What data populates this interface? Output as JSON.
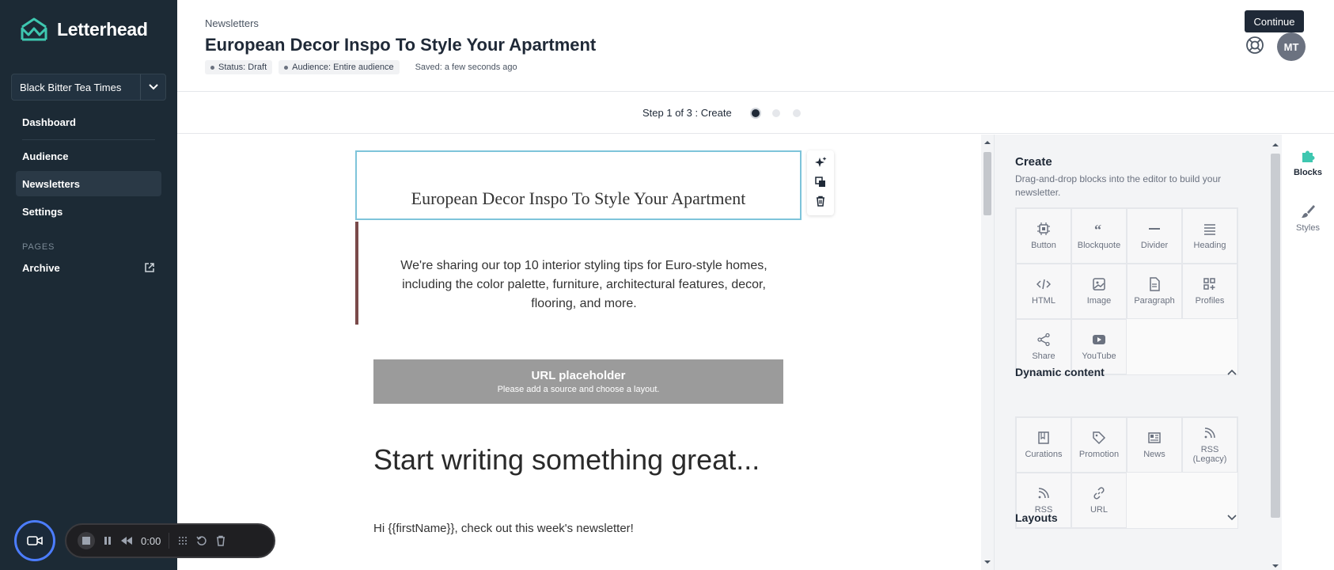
{
  "sidebar": {
    "logo_text": "Letterhead",
    "publication": "Black Bitter Tea Times",
    "nav": [
      {
        "label": "Dashboard"
      },
      {
        "label": "Audience"
      },
      {
        "label": "Newsletters"
      },
      {
        "label": "Settings"
      }
    ],
    "pages_section": "PAGES",
    "archive_label": "Archive"
  },
  "header": {
    "breadcrumb": "Newsletters",
    "title": "European Decor Inspo To Style Your Apartment",
    "status": "Status: Draft",
    "audience": "Audience: Entire audience",
    "saved": "Saved: a few seconds ago",
    "avatar_initials": "MT"
  },
  "steps": {
    "label": "Step 1 of 3 : Create",
    "current": 1,
    "total": 3,
    "continue_label": "Continue"
  },
  "editor": {
    "block_title": "European Decor Inspo To Style Your Apartment",
    "intro": "We're sharing our top 10 interior styling tips for Euro-style homes, including the color palette, furniture, architectural features, decor, flooring, and more.",
    "url_title": "URL placeholder",
    "url_subtitle": "Please add a source and choose a layout.",
    "heading": "Start writing something great...",
    "greeting": "Hi {{firstName}}, check out this week's newsletter!"
  },
  "panel": {
    "create_title": "Create",
    "create_desc": "Drag-and-drop blocks into the editor to build your newsletter.",
    "blocks": [
      {
        "label": "Button",
        "icon": "button-icon"
      },
      {
        "label": "Blockquote",
        "icon": "quote-icon"
      },
      {
        "label": "Divider",
        "icon": "divider-icon"
      },
      {
        "label": "Heading",
        "icon": "heading-icon"
      },
      {
        "label": "HTML",
        "icon": "code-icon"
      },
      {
        "label": "Image",
        "icon": "image-icon"
      },
      {
        "label": "Paragraph",
        "icon": "paragraph-icon"
      },
      {
        "label": "Profiles",
        "icon": "profiles-icon"
      },
      {
        "label": "Share",
        "icon": "share-icon"
      },
      {
        "label": "YouTube",
        "icon": "youtube-icon"
      }
    ],
    "dynamic_title": "Dynamic content",
    "dynamic": [
      {
        "label": "Curations",
        "icon": "book-icon"
      },
      {
        "label": "Promotion",
        "icon": "tag-icon"
      },
      {
        "label": "News",
        "icon": "news-icon"
      },
      {
        "label": "RSS (Legacy)",
        "icon": "rss-icon"
      },
      {
        "label": "RSS",
        "icon": "rss-icon"
      },
      {
        "label": "URL",
        "icon": "link-icon"
      }
    ],
    "layouts_title": "Layouts"
  },
  "side_tabs": {
    "blocks": "Blocks",
    "styles": "Styles"
  },
  "recorder": {
    "time": "0:00"
  },
  "colors": {
    "sidebar_bg": "#1c2a35",
    "accent_teal": "#3ec7b0",
    "primary_dark": "#1f2937",
    "selection_border": "#7ec4da"
  }
}
